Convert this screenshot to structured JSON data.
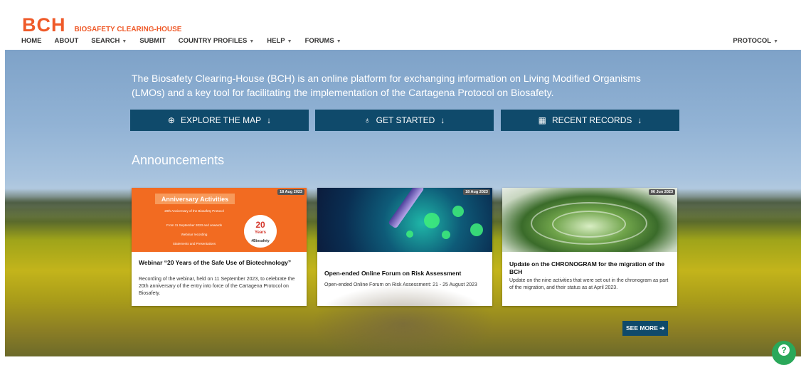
{
  "logo": {
    "main": "BCH",
    "sub": "BIOSAFETY CLEARING-HOUSE"
  },
  "nav": {
    "items": [
      {
        "label": "HOME"
      },
      {
        "label": "ABOUT"
      },
      {
        "label": "SEARCH"
      },
      {
        "label": "SUBMIT"
      },
      {
        "label": "COUNTRY PROFILES"
      },
      {
        "label": "HELP"
      },
      {
        "label": "FORUMS"
      }
    ],
    "right": "PROTOCOL"
  },
  "intro": "The Biosafety Clearing-House (BCH) is an online platform for exchanging information on Living Modified Organisms (LMOs) and a key tool for facilitating the implementation of the Cartagena Protocol on Biosafety.",
  "cta": {
    "explore": "EXPLORE THE MAP",
    "started": "GET STARTED",
    "recent": "RECENT RECORDS"
  },
  "announcements": {
    "title": "Announcements",
    "cards": [
      {
        "date": "18 Aug 2023",
        "title": "Webinar “20 Years of the Safe Use of Biotechnology”",
        "desc": "Recording of the webinar, held on 11 September 2023, to celebrate the 20th anniversary of the entry into force of the Cartagena Protocol on Biosafety.",
        "img": {
          "banner": "Anniversary Activities",
          "line1": "20th Anniversary of the Biosafety Protocol",
          "line2": "From 11 September 2023 and onwards",
          "line3": "Webinar recording",
          "line4": "Statements and Presentations",
          "seal_num": "20",
          "seal_years": "Years",
          "seal_tag": "#Biosafety"
        }
      },
      {
        "date": "18 Aug 2023",
        "title": "Open-ended Online Forum on Risk Assessment",
        "desc": "Open-ended Online Forum on Risk Assessment: 21 - 25 August 2023"
      },
      {
        "date": "06 Jun 2023",
        "title": "Update on the CHRONOGRAM for the migration of the BCH",
        "desc": "Update on the nine activities that were set out in the chronogram as part of the migration, and their status as at April 2023."
      }
    ],
    "see_more": "SEE MORE"
  },
  "icons": {
    "globe": "globe-icon",
    "bulb": "lightbulb-icon",
    "table": "table-icon",
    "help": "help-chat-icon"
  },
  "colors": {
    "brand": "#ef5a29",
    "button": "#0f4a6b",
    "help": "#2aa85a"
  }
}
